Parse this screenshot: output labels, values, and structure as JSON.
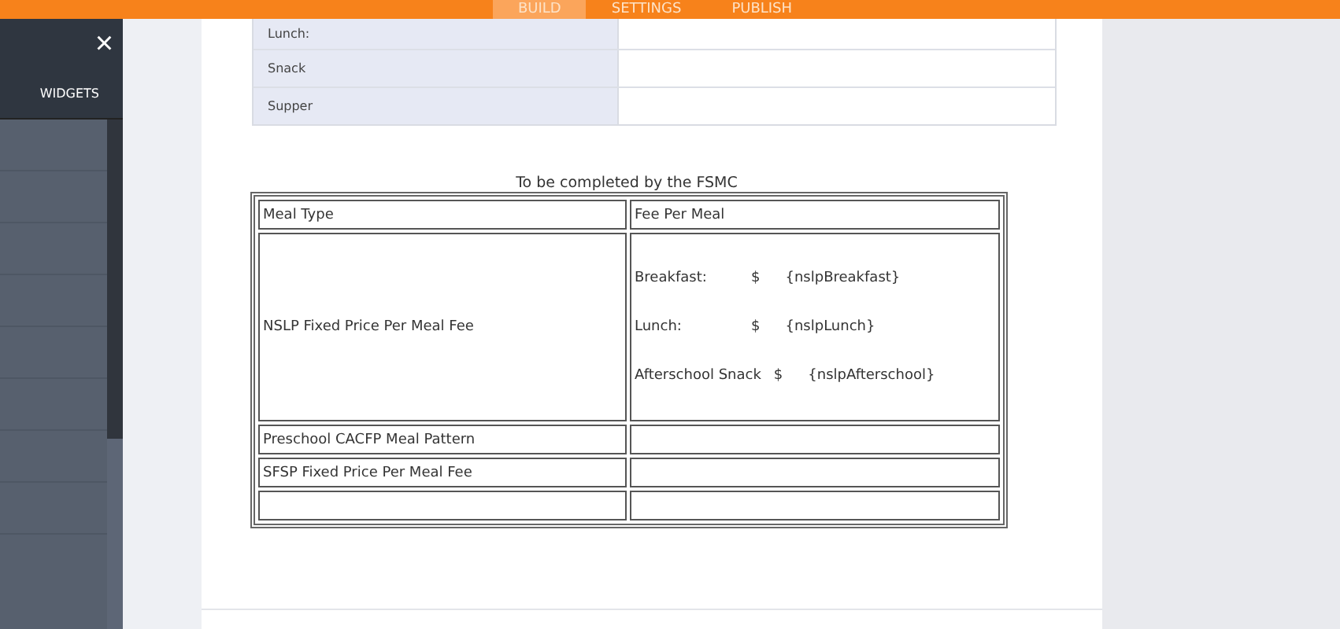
{
  "top_tabs": [
    {
      "label": "BUILD",
      "selected": true
    },
    {
      "label": "SETTINGS",
      "selected": false
    },
    {
      "label": "PUBLISH",
      "selected": false
    }
  ],
  "sidebar": {
    "close": "×",
    "tab": "WIDGETS"
  },
  "meal_times": [
    {
      "label": "Lunch:"
    },
    {
      "label": "Snack"
    },
    {
      "label": "Supper"
    }
  ],
  "fsmc_table": {
    "caption": "To be completed by the FSMC",
    "columns": [
      "Meal Type",
      "Fee Per Meal"
    ],
    "rows": [
      {
        "meal_type": "NSLP Fixed Price Per Meal Fee",
        "fees": [
          {
            "label": "Breakfast:",
            "currency": "$",
            "value": "{nslpBreakfast}"
          },
          {
            "label": "Lunch:",
            "currency": "$",
            "value": "{nslpLunch}"
          },
          {
            "label": "Afterschool Snack",
            "currency": "$",
            "value": "{nslpAfterschool}"
          }
        ]
      },
      {
        "meal_type": "Preschool CACFP Meal Pattern",
        "fees": []
      },
      {
        "meal_type": "SFSP Fixed Price Per Meal Fee",
        "fees": []
      },
      {
        "meal_type": "",
        "fees": []
      }
    ]
  }
}
